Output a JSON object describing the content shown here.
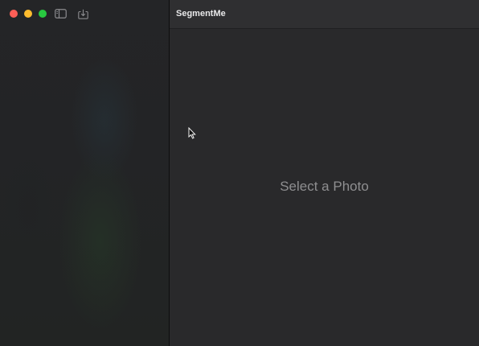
{
  "window": {
    "traffic_lights": {
      "close_color": "#fe5f57",
      "minimize_color": "#febc2e",
      "maximize_color": "#28c840"
    }
  },
  "toolbar": {
    "sidebar_toggle_icon": "sidebar-left-icon",
    "import_icon": "tray-arrow-down-icon"
  },
  "main": {
    "title": "SegmentMe",
    "placeholder": "Select a Photo"
  }
}
